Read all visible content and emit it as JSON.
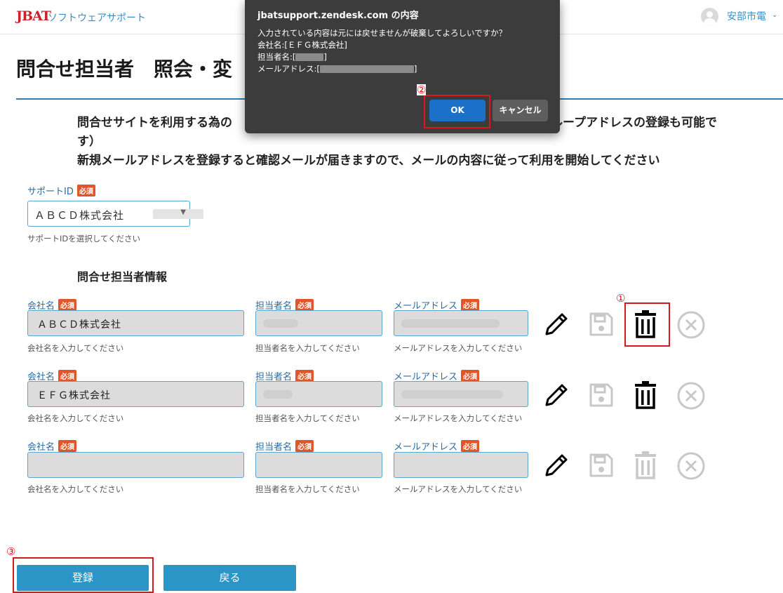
{
  "header": {
    "logo": "JBAT",
    "subtitle": "ソフトウェアサポート",
    "user_name": "安部市電"
  },
  "page": {
    "title": "問合せ担当者　照会・変",
    "intro_line1": "問合せサイトを利用する為の",
    "intro_line1_tail": "（グループアドレスの登録も可能で",
    "intro_line1_wrap": "す）",
    "intro_line2": "新規メールアドレスを登録すると確認メールが届きますので、メールの内容に従って利用を開始してください"
  },
  "support_id": {
    "label": "サポートID",
    "required": "必須",
    "value": "ＡＢＣＤ株式会社",
    "help": "サポートIDを選択してください"
  },
  "contacts_section": {
    "title": "問合せ担当者情報"
  },
  "form_labels": {
    "company": "会社名",
    "person": "担当者名",
    "email": "メールアドレス",
    "required": "必須",
    "company_help": "会社名を入力してください",
    "person_help": "担当者名を入力してください",
    "email_help": "メールアドレスを入力してください"
  },
  "contacts": [
    {
      "company": "ＡＢＣＤ株式会社"
    },
    {
      "company": "ＥＦＧ株式会社"
    },
    {
      "company": ""
    }
  ],
  "step_markers": {
    "one": "①",
    "two": "②",
    "three": "③"
  },
  "buttons": {
    "register": "登録",
    "back": "戻る"
  },
  "dialog": {
    "title": "jbatsupport.zendesk.com の内容",
    "message": "入力されている内容は元には戻せませんが破棄してよろしいですか？",
    "company_line": "会社名:[ＥＦＧ株式会社]",
    "person_prefix": "担当者名:[",
    "email_prefix": "メールアドレス:[",
    "close_bracket": "]",
    "ok": "OK",
    "cancel": "キャンセル"
  },
  "colors": {
    "accent": "#2b95c8",
    "required_badge": "#e0552a",
    "highlight": "#d51a1a",
    "dialog_bg": "#3c3c3c",
    "ok_button": "#1b70c8"
  },
  "icons": {
    "edit": "pencil-icon",
    "save": "save-icon",
    "delete": "trash-icon",
    "clear": "close-circle-icon",
    "user": "user-avatar-icon"
  }
}
